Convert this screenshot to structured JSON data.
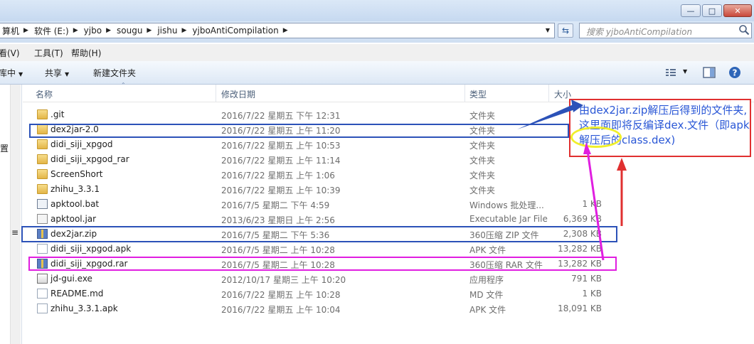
{
  "window": {
    "minimize_label": "—",
    "maximize_label": "□",
    "close_label": "✕"
  },
  "address": {
    "crumbs": [
      "算机",
      "软件 (E:)",
      "yjbo",
      "sougu",
      "jishu",
      "yjboAntiCompilation"
    ],
    "refresh_icon": "refresh-icon",
    "search_placeholder": "搜索 yjboAntiCompilation"
  },
  "menu": {
    "view": "看(V)",
    "tools": "工具(T)",
    "help": "帮助(H)"
  },
  "toolbar": {
    "library": "库中",
    "share": "共享",
    "new_folder": "新建文件夹"
  },
  "columns": {
    "name": "名称",
    "date": "修改日期",
    "type": "类型",
    "size": "大小"
  },
  "files": [
    {
      "name": ".git",
      "date": "2016/7/22 星期五 下午 12:31",
      "type": "文件夹",
      "size": "",
      "icon": "folder"
    },
    {
      "name": "dex2jar-2.0",
      "date": "2016/7/22 星期五 上午 11:20",
      "type": "文件夹",
      "size": "",
      "icon": "folder"
    },
    {
      "name": "didi_siji_xpgod",
      "date": "2016/7/22 星期五 上午 10:53",
      "type": "文件夹",
      "size": "",
      "icon": "folder"
    },
    {
      "name": "didi_siji_xpgod_rar",
      "date": "2016/7/22 星期五 上午 11:14",
      "type": "文件夹",
      "size": "",
      "icon": "folder"
    },
    {
      "name": "ScreenShort",
      "date": "2016/7/22 星期五 上午 1:06",
      "type": "文件夹",
      "size": "",
      "icon": "folder"
    },
    {
      "name": "zhihu_3.3.1",
      "date": "2016/7/22 星期五 上午 10:39",
      "type": "文件夹",
      "size": "",
      "icon": "folder"
    },
    {
      "name": "apktool.bat",
      "date": "2016/7/5 星期二 下午 4:59",
      "type": "Windows 批处理...",
      "size": "1 KB",
      "icon": "bat"
    },
    {
      "name": "apktool.jar",
      "date": "2013/6/23 星期日 上午 2:56",
      "type": "Executable Jar File",
      "size": "6,369 KB",
      "icon": "jar"
    },
    {
      "name": "dex2jar.zip",
      "date": "2016/7/5 星期二 下午 5:36",
      "type": "360压缩 ZIP 文件",
      "size": "2,308 KB",
      "icon": "zip"
    },
    {
      "name": "didi_siji_xpgod.apk",
      "date": "2016/7/5 星期二 上午 10:28",
      "type": "APK 文件",
      "size": "13,282 KB",
      "icon": "doc"
    },
    {
      "name": "didi_siji_xpgod.rar",
      "date": "2016/7/5 星期二 上午 10:28",
      "type": "360压缩 RAR 文件",
      "size": "13,282 KB",
      "icon": "zip"
    },
    {
      "name": "jd-gui.exe",
      "date": "2012/10/17 星期三 上午 10:20",
      "type": "应用程序",
      "size": "791 KB",
      "icon": "exe"
    },
    {
      "name": "README.md",
      "date": "2016/7/22 星期五 上午 10:28",
      "type": "MD 文件",
      "size": "1 KB",
      "icon": "doc"
    },
    {
      "name": "zhihu_3.3.1.apk",
      "date": "2016/7/22 星期五 上午 10:04",
      "type": "APK 文件",
      "size": "18,091 KB",
      "icon": "doc"
    }
  ],
  "annotation": {
    "note_text": "由dex2jar.zip解压后得到的文件夹,这里面即将反编译dex.文件（即apk解压后的class.dex)",
    "colors": {
      "blue_box": "#2c52b8",
      "magenta_box": "#e01ee0",
      "red_box": "#e03030",
      "yellow_ellipse": "#f0ef2a",
      "note_text": "#2a57d6"
    }
  },
  "nav_pane": {
    "partial_label_1": "置",
    "partial_label_2": "≡"
  }
}
